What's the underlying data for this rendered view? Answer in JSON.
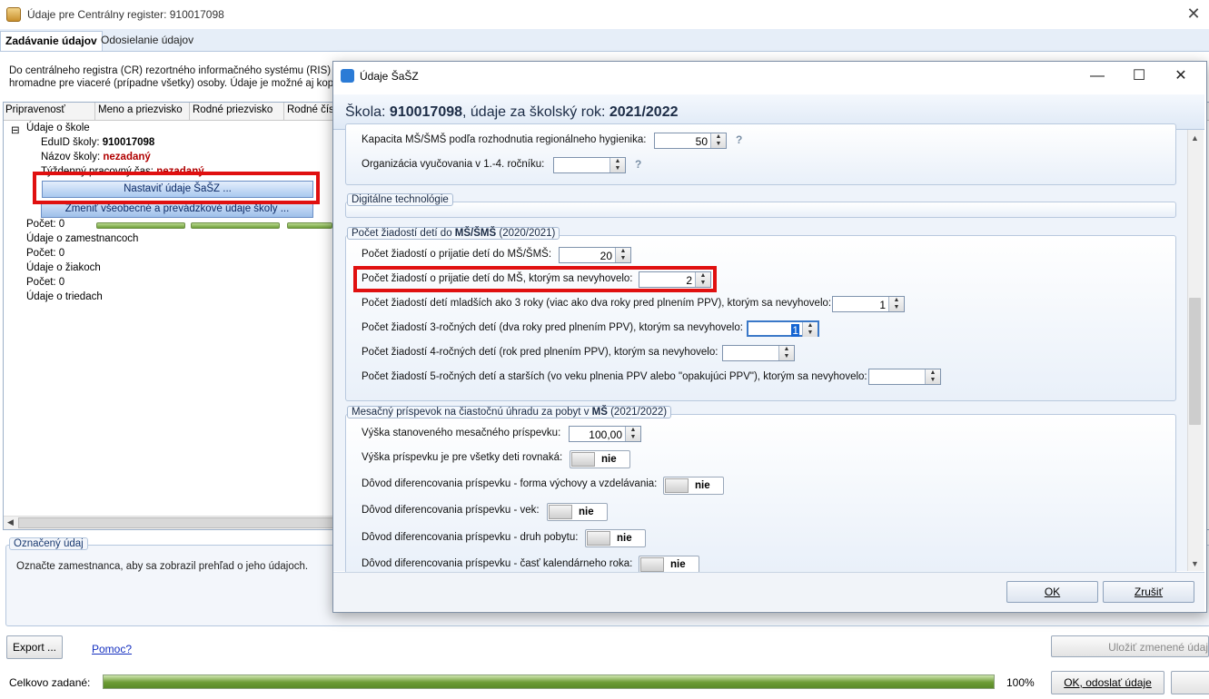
{
  "main": {
    "title": "Údaje pre Centrálny register: 910017098",
    "close_glyph": "✕",
    "tabs": [
      {
        "label": "Zadávanie údajov"
      },
      {
        "label": "Odosielanie údajov"
      }
    ],
    "description_line1": "Do centrálneho registra (CR) rezortného informačného systému (RIS) sa o",
    "description_line2": "hromadne pre viaceré (prípadne všetky) osoby. Údaje je možné aj kopírov",
    "columns": [
      "Pripravenosť",
      "Meno a priezvisko",
      "Rodné priezvisko",
      "Rodné čís"
    ],
    "tree": {
      "school": "Údaje o škole",
      "eduid_label": "EduID školy:",
      "eduid_value": "910017098",
      "name_label": "Názov školy:",
      "name_value": "nezadaný",
      "hours_label": "Týždenný pracovný čas:",
      "hours_value": "nezadaný",
      "btn_sasz": "Nastaviť údaje ŠaŠZ ...",
      "btn_general": "Zmeniť všeobecné a prevádzkové údaje školy ...",
      "count0": "Počet: 0",
      "employees": "Údaje o zamestnancoch",
      "count1": "Počet: 0",
      "pupils": "Údaje o žiakoch",
      "count2": "Počet: 0",
      "classes": "Údaje o triedach"
    },
    "selected_legend": "Označený údaj",
    "selected_text": "Označte zamestnanca, aby sa zobrazil prehľad o jeho údajoch.",
    "export_btn": "Export ...",
    "help_link": "Pomoc?",
    "save_btn": "Uložiť zmenené údaj",
    "status_label": "Celkovo zadané:",
    "status_progress": 1.0,
    "status_pct": "100%",
    "send_btn": "OK, odoslať údaje"
  },
  "dialog": {
    "title": "Údaje ŠaŠZ",
    "controls": {
      "minimize": "—",
      "maximize": "☐",
      "close": "✕"
    },
    "school_prefix": "Škola: ",
    "school_id": "910017098",
    "school_mid": ", údaje za školský rok: ",
    "school_year": "2021/2022",
    "capacity_label": "Kapacita MŠ/ŠMŠ podľa rozhodnutia regionálneho hygienika:",
    "capacity_value": "50",
    "org_label": "Organizácia vyučovania v 1.-4. ročníku:",
    "org_value": "",
    "help_mark": "?",
    "digital_legend": "Digitálne technológie",
    "requests_legend_pre": "Počet žiadostí detí do ",
    "requests_legend_bold": "MŠ/ŠMŠ",
    "requests_legend_post": " (2020/2021)",
    "requests": [
      {
        "label": "Počet žiadostí o prijatie detí do MŠ/ŠMŠ:",
        "value": "20"
      },
      {
        "label": "Počet žiadostí o prijatie detí do MŠ, ktorým sa nevyhovelo:",
        "value": "2"
      },
      {
        "label": "Počet žiadostí detí mladších ako 3 roky (viac ako dva roky pred plnením PPV), ktorým sa nevyhovelo:",
        "value": "1"
      },
      {
        "label": "Počet žiadostí 3-ročných detí (dva roky pred plnením PPV), ktorým sa nevyhovelo:",
        "value": "1"
      },
      {
        "label": "Počet žiadostí 4-ročných detí (rok pred plnením PPV), ktorým sa nevyhovelo:",
        "value": ""
      },
      {
        "label": "Počet žiadostí 5-ročných detí a starších (vo veku plnenia PPV alebo \"opakujúci PPV\"), ktorým sa nevyhovelo:",
        "value": ""
      }
    ],
    "fee_legend_pre": "Mesačný príspevok na čiastočnú úhradu za pobyt v ",
    "fee_legend_bold": "MŠ",
    "fee_legend_post": " (2021/2022)",
    "fee_amount_label": "Výška stanoveného mesačného príspevku:",
    "fee_amount_value": "100,00",
    "fee_toggles": [
      {
        "label": "Výška príspevku je pre všetky deti rovnaká:",
        "value": "nie"
      },
      {
        "label": "Dôvod diferencovania príspevku - forma výchovy a vzdelávania:",
        "value": "nie"
      },
      {
        "label": "Dôvod diferencovania príspevku - vek:",
        "value": "nie"
      },
      {
        "label": "Dôvod diferencovania príspevku - druh pobytu:",
        "value": "nie"
      },
      {
        "label": "Dôvod diferencovania príspevku - časť kalendárneho roka:",
        "value": "nie"
      }
    ],
    "ok_btn": "OK",
    "cancel_btn": "Zrušiť"
  },
  "colors": {
    "accent_red": "#e01010",
    "progress_green": "#6c9b34",
    "link_blue": "#1530c0"
  }
}
